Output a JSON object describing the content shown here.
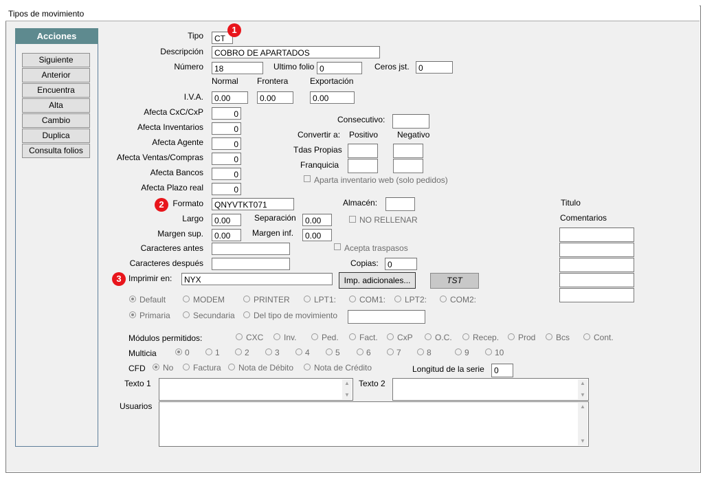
{
  "window": {
    "title": "Tipos de movimiento"
  },
  "sidebar": {
    "header": "Acciones",
    "buttons": [
      "Siguiente",
      "Anterior",
      "Encuentra",
      "Alta",
      "Cambio",
      "Duplica",
      "Consulta folios"
    ]
  },
  "badges": [
    "1",
    "2",
    "3"
  ],
  "form": {
    "tipo_label": "Tipo",
    "tipo_value": "CT",
    "descripcion_label": "Descripción",
    "descripcion_value": "COBRO DE APARTADOS",
    "numero_label": "Número",
    "numero_value": "18",
    "ultimo_folio_label": "Ultimo folio",
    "ultimo_folio_value": "0",
    "ceros_label": "Ceros jst.",
    "ceros_value": "0",
    "col_normal": "Normal",
    "col_frontera": "Frontera",
    "col_exportacion": "Exportación",
    "iva_label": "I.V.A.",
    "iva_normal": "0.00",
    "iva_frontera": "0.00",
    "iva_exportacion": "0.00",
    "afecta": [
      {
        "label": "Afecta  CxC/CxP",
        "value": "0"
      },
      {
        "label": "Afecta  Inventarios",
        "value": "0"
      },
      {
        "label": "Afecta  Agente",
        "value": "0"
      },
      {
        "label": "Afecta  Ventas/Compras",
        "value": "0"
      },
      {
        "label": "Afecta  Bancos",
        "value": "0"
      },
      {
        "label": "Afecta  Plazo real",
        "value": "0"
      }
    ],
    "consecutivo_label": "Consecutivo:",
    "consecutivo_value": "",
    "convertir_label": "Convertir a:",
    "positivo_label": "Positivo",
    "negativo_label": "Negativo",
    "tdas_propias_label": "Tdas Propias",
    "franquicia_label": "Franquicia",
    "aparta_web_label": "Aparta inventario web (solo pedidos)",
    "formato_label": "Formato",
    "formato_value": "QNYVTKT071",
    "almacen_label": "Almacén:",
    "almacen_value": "",
    "largo_label": "Largo",
    "largo_value": "0.00",
    "separacion_label": "Separación",
    "separacion_value": "0.00",
    "no_rellenar_label": "NO RELLENAR",
    "margen_sup_label": "Margen sup.",
    "margen_sup_value": "0.00",
    "margen_inf_label": "Margen inf.",
    "margen_inf_value": "0.00",
    "car_antes_label": "Caracteres antes",
    "car_antes_value": "",
    "acepta_traspasos_label": "Acepta traspasos",
    "car_despues_label": "Caracteres después",
    "car_despues_value": "",
    "copias_label": "Copias:",
    "copias_value": "0",
    "imprimir_label": "Imprimir en:",
    "imprimir_value": "NYX",
    "imp_adicionales_label": "Imp. adicionales...",
    "tst_label": "TST",
    "titulo_label": "Titulo",
    "comentarios_label": "Comentarios",
    "printer_options": [
      "Default",
      "MODEM",
      "PRINTER",
      "LPT1:",
      "COM1:",
      "LPT2:",
      "COM2:"
    ],
    "printer_selected": "Default",
    "source_options": [
      "Primaria",
      "Secundaria",
      "Del tipo de movimiento"
    ],
    "source_selected": "Primaria",
    "modulos_label": "Módulos permitidos:",
    "modulos": [
      "CXC",
      "Inv.",
      "Ped.",
      "Fact.",
      "CxP",
      "O.C.",
      "Recep.",
      "Prod",
      "Bcs",
      "Cont."
    ],
    "multicia_label": "Multicia",
    "multicia_options": [
      "0",
      "1",
      "2",
      "3",
      "4",
      "5",
      "6",
      "7",
      "8",
      "9",
      "10"
    ],
    "multicia_selected": "0",
    "cfd_label": "CFD",
    "cfd_options": [
      "No",
      "Factura",
      "Nota de Débito",
      "Nota de Crédito"
    ],
    "cfd_selected": "No",
    "longitud_serie_label": "Longitud de la serie",
    "longitud_serie_value": "0",
    "texto1_label": "Texto 1",
    "texto2_label": "Texto 2",
    "usuarios_label": "Usuarios"
  }
}
